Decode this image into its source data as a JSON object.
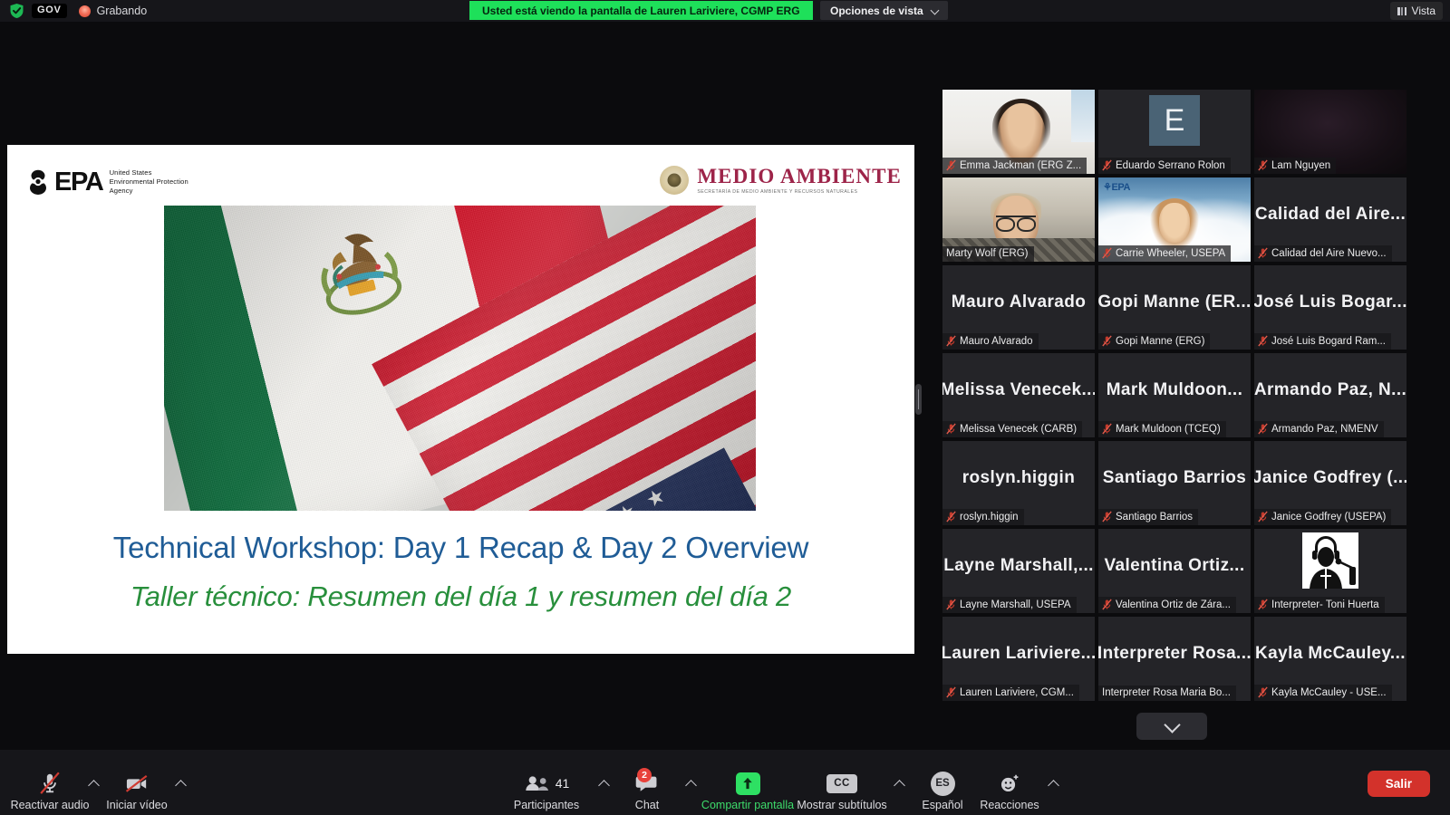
{
  "topbar": {
    "shield_icon": "shield-check-icon",
    "gov_badge": "GOV",
    "recording_icon": "recording-dot-icon",
    "recording_label": "Grabando",
    "share_banner": "Usted está viendo la pantalla de Lauren Lariviere, CGMP ERG",
    "view_options_label": "Opciones de vista",
    "view_options_caret": "chevron-down-icon",
    "vista_label": "Vista",
    "vista_icon": "grid-view-icon"
  },
  "shared_screen": {
    "epa_logo": {
      "wordmark": "EPA",
      "subtitle": "United States\nEnvironmental Protection\nAgency",
      "line1": "United States",
      "line2": "Environmental Protection",
      "line3": "Agency"
    },
    "semarnat_logo": {
      "title": "MEDIO AMBIENTE",
      "tagline": "SECRETARÍA DE MEDIO AMBIENTE Y RECURSOS NATURALES",
      "seal_icon": "mexico-national-seal-icon"
    },
    "image_alt": "mexico-usa-flags-photo",
    "title": "Technical Workshop: Day 1 Recap & Day 2 Overview",
    "subtitle": "Taller técnico: Resumen del día 1 y resumen del día 2",
    "title_color": "#1f5c96",
    "subtitle_color": "#288f3c",
    "drag_handle_icon": "panel-resize-handle-icon"
  },
  "gallery": {
    "scroll_down_icon": "chevron-down-icon",
    "tiles": [
      {
        "display_name": "Emma Jackman (ERG Z...",
        "placeholder": "",
        "kind": "video",
        "video": "emma",
        "muted": true,
        "speaking": false
      },
      {
        "display_name": "Eduardo Serrano Rolon",
        "placeholder": "E",
        "kind": "avatar-letter",
        "avatar_color": "#4a6375",
        "muted": true,
        "speaking": false
      },
      {
        "display_name": "Lam Nguyen",
        "placeholder": "",
        "kind": "video",
        "video": "dark",
        "muted": true,
        "speaking": false
      },
      {
        "display_name": "Marty Wolf (ERG)",
        "placeholder": "",
        "kind": "video",
        "video": "marty",
        "muted": false,
        "speaking": true
      },
      {
        "display_name": "Carrie Wheeler, USEPA",
        "placeholder": "",
        "kind": "video",
        "video": "carrie",
        "muted": true,
        "speaking": false
      },
      {
        "display_name": "Calidad del Aire Nuevo...",
        "placeholder": "Calidad del Aire...",
        "kind": "name-only",
        "muted": true,
        "speaking": false
      },
      {
        "display_name": "Mauro Alvarado",
        "placeholder": "Mauro Alvarado",
        "kind": "name-only",
        "muted": true,
        "speaking": false
      },
      {
        "display_name": "Gopi Manne (ERG)",
        "placeholder": "Gopi Manne (ER...",
        "kind": "name-only",
        "muted": true,
        "speaking": false
      },
      {
        "display_name": "José Luis Bogard Ram...",
        "placeholder": "José Luis Bogar...",
        "kind": "name-only",
        "muted": true,
        "speaking": false
      },
      {
        "display_name": "Melissa Venecek (CARB)",
        "placeholder": "Melissa Venecek...",
        "kind": "name-only",
        "muted": true,
        "speaking": false
      },
      {
        "display_name": "Mark Muldoon (TCEQ)",
        "placeholder": "Mark Muldoon...",
        "kind": "name-only",
        "muted": true,
        "speaking": false
      },
      {
        "display_name": "Armando Paz, NMENV",
        "placeholder": "Armando Paz, N...",
        "kind": "name-only",
        "muted": true,
        "speaking": false
      },
      {
        "display_name": "roslyn.higgin",
        "placeholder": "roslyn.higgin",
        "kind": "name-only",
        "muted": true,
        "speaking": false
      },
      {
        "display_name": "Santiago Barrios",
        "placeholder": "Santiago Barrios",
        "kind": "name-only",
        "muted": true,
        "speaking": false
      },
      {
        "display_name": "Janice Godfrey (USEPA)",
        "placeholder": "Janice Godfrey (...",
        "kind": "name-only",
        "muted": true,
        "speaking": false
      },
      {
        "display_name": "Layne Marshall, USEPA",
        "placeholder": "Layne  Marshall,...",
        "kind": "name-only",
        "muted": true,
        "speaking": false
      },
      {
        "display_name": "Valentina Ortiz de Zára...",
        "placeholder": "Valentina  Ortiz...",
        "kind": "name-only",
        "muted": true,
        "speaking": false
      },
      {
        "display_name": "Interpreter- Toni Huerta",
        "placeholder": "",
        "kind": "avatar-image",
        "avatar_icon": "interpreter-headset-icon",
        "muted": true,
        "speaking": false
      },
      {
        "display_name": "Lauren Lariviere, CGM...",
        "placeholder": "Lauren  Lariviere...",
        "kind": "name-only",
        "muted": true,
        "speaking": false
      },
      {
        "display_name": "Interpreter Rosa Maria Bo...",
        "placeholder": "Interpreter  Rosa...",
        "kind": "name-only",
        "muted": false,
        "speaking": false
      },
      {
        "display_name": "Kayla McCauley - USE...",
        "placeholder": "Kayla  McCauley...",
        "kind": "name-only",
        "muted": true,
        "speaking": false
      }
    ]
  },
  "toolbar": {
    "audio": {
      "label": "Reactivar audio",
      "icon": "microphone-muted-icon",
      "caret": "chevron-up-icon"
    },
    "video": {
      "label": "Iniciar vídeo",
      "icon": "camera-off-icon",
      "caret": "chevron-up-icon"
    },
    "participants": {
      "label": "Participantes",
      "count": "41",
      "icon": "participants-icon",
      "caret": "chevron-up-icon"
    },
    "chat": {
      "label": "Chat",
      "badge": "2",
      "icon": "chat-bubble-icon",
      "caret": "chevron-up-icon"
    },
    "share": {
      "label": "Compartir pantalla",
      "icon": "share-screen-arrow-icon"
    },
    "captions": {
      "label": "Mostrar subtítulos",
      "icon": "closed-caption-icon",
      "caret": "chevron-up-icon"
    },
    "language": {
      "label": "Español",
      "icon": "ES"
    },
    "reactions": {
      "label": "Reacciones",
      "icon": "smiley-plus-icon",
      "caret": "chevron-up-icon"
    },
    "leave": {
      "label": "Salir"
    }
  },
  "colors": {
    "accent_green": "#1ee05a",
    "speaking_border": "#b8e04a",
    "leave_red": "#d3322b",
    "badge_red": "#e8413a",
    "chrome_bg": "#16161a",
    "tile_bg": "#242428"
  }
}
